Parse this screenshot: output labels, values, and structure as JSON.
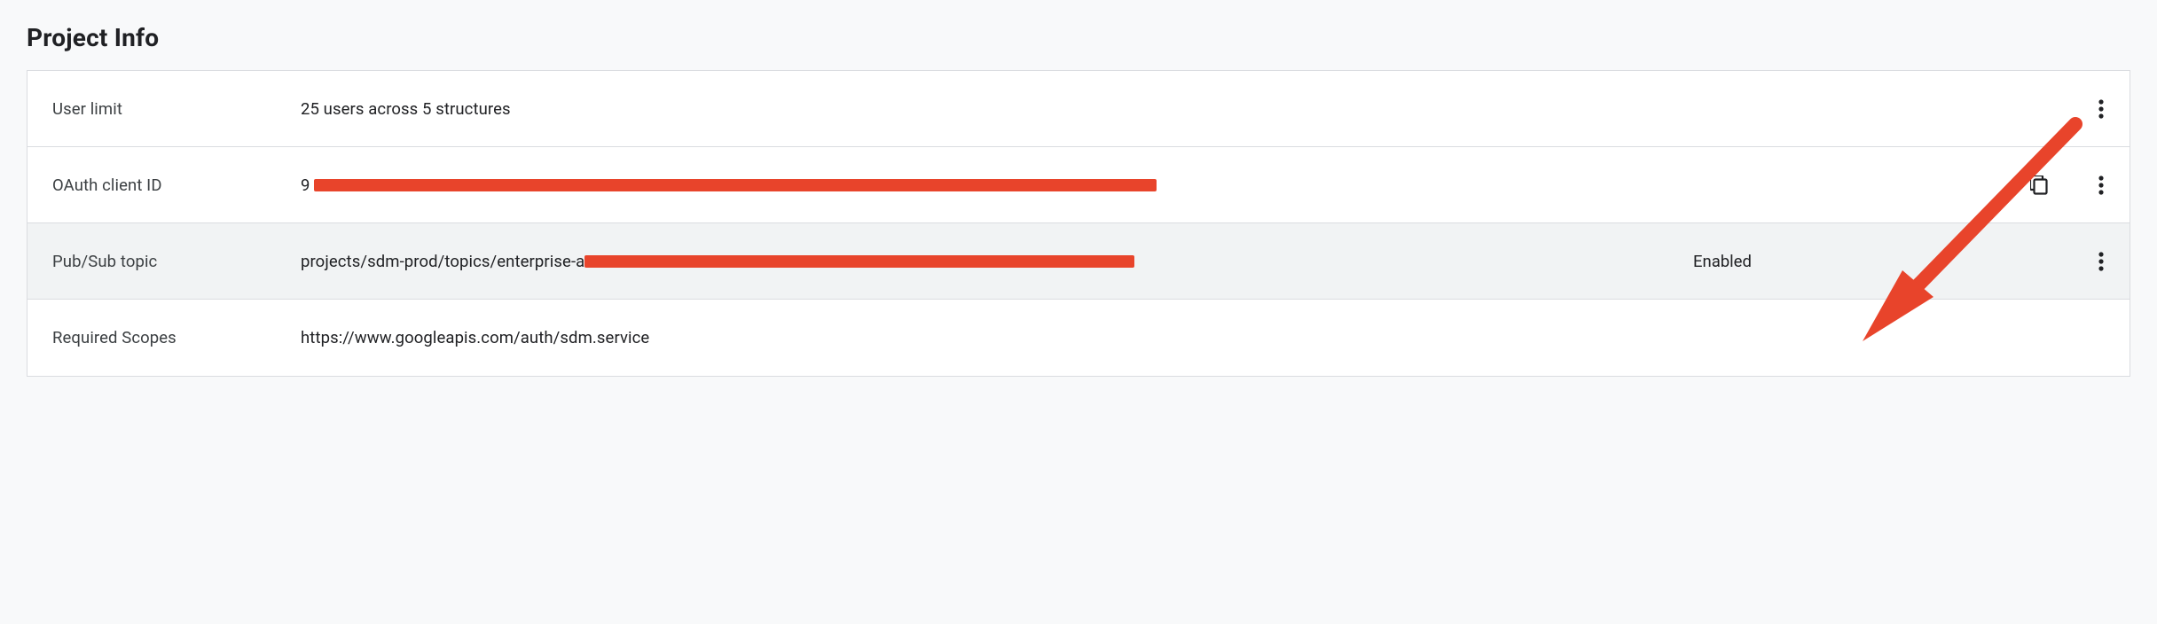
{
  "title": "Project Info",
  "rows": {
    "user_limit": {
      "label": "User limit",
      "value": "25 users across 5 structures"
    },
    "oauth": {
      "label": "OAuth client ID",
      "value_prefix": "9"
    },
    "pubsub": {
      "label": "Pub/Sub topic",
      "value_prefix": "projects/sdm-prod/topics/enterprise-a",
      "status": "Enabled"
    },
    "scopes": {
      "label": "Required Scopes",
      "value": "https://www.googleapis.com/auth/sdm.service"
    }
  },
  "annotation": {
    "color": "#E8442B"
  }
}
